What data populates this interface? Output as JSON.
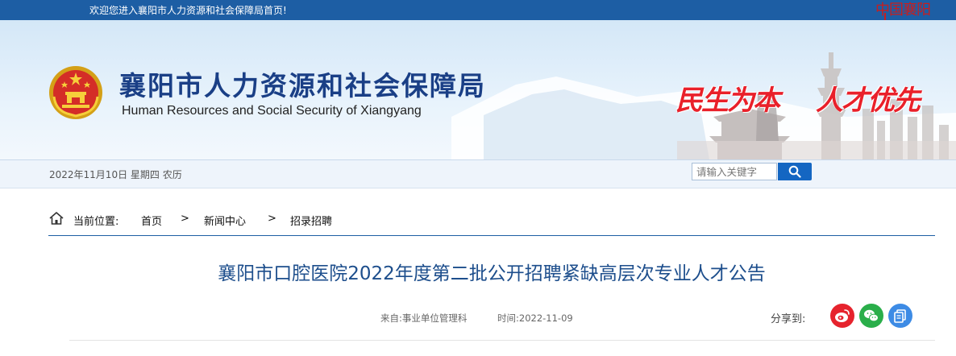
{
  "top_bar": {
    "welcome_text": "欢迎您进入襄阳市人力资源和社会保障局首页!",
    "calligraphy_logo": "中国襄阳"
  },
  "header": {
    "title": "襄阳市人力资源和社会保障局",
    "subtitle": "Human Resources and Social Security of Xiangyang",
    "slogan_left": "民生为本",
    "slogan_right": "人才优先",
    "emblem_icon": "national-emblem-icon"
  },
  "date_bar": {
    "date_text": "2022年11月10日 星期四 农历",
    "search_placeholder": "请输入关键字",
    "search_icon": "search-icon"
  },
  "breadcrumb": {
    "label": "当前位置:",
    "items": [
      "首页",
      "新闻中心",
      "招录招聘"
    ],
    "separator": ">"
  },
  "article": {
    "title": "襄阳市口腔医院2022年度第二批公开招聘紧缺高层次专业人才公告",
    "source": "来自:事业单位管理科",
    "time": "时间:2022-11-09"
  },
  "share": {
    "label": "分享到:",
    "buttons": [
      {
        "name": "weibo",
        "icon": "weibo-icon",
        "color": "#e6232d"
      },
      {
        "name": "wechat",
        "icon": "wechat-icon",
        "color": "#2aae4a"
      },
      {
        "name": "copy",
        "icon": "copy-icon",
        "color": "#3d8be5"
      }
    ]
  },
  "colors": {
    "brand_blue": "#1d5ea4",
    "title_blue": "#1a3f86",
    "slogan_red": "#e9202a"
  }
}
